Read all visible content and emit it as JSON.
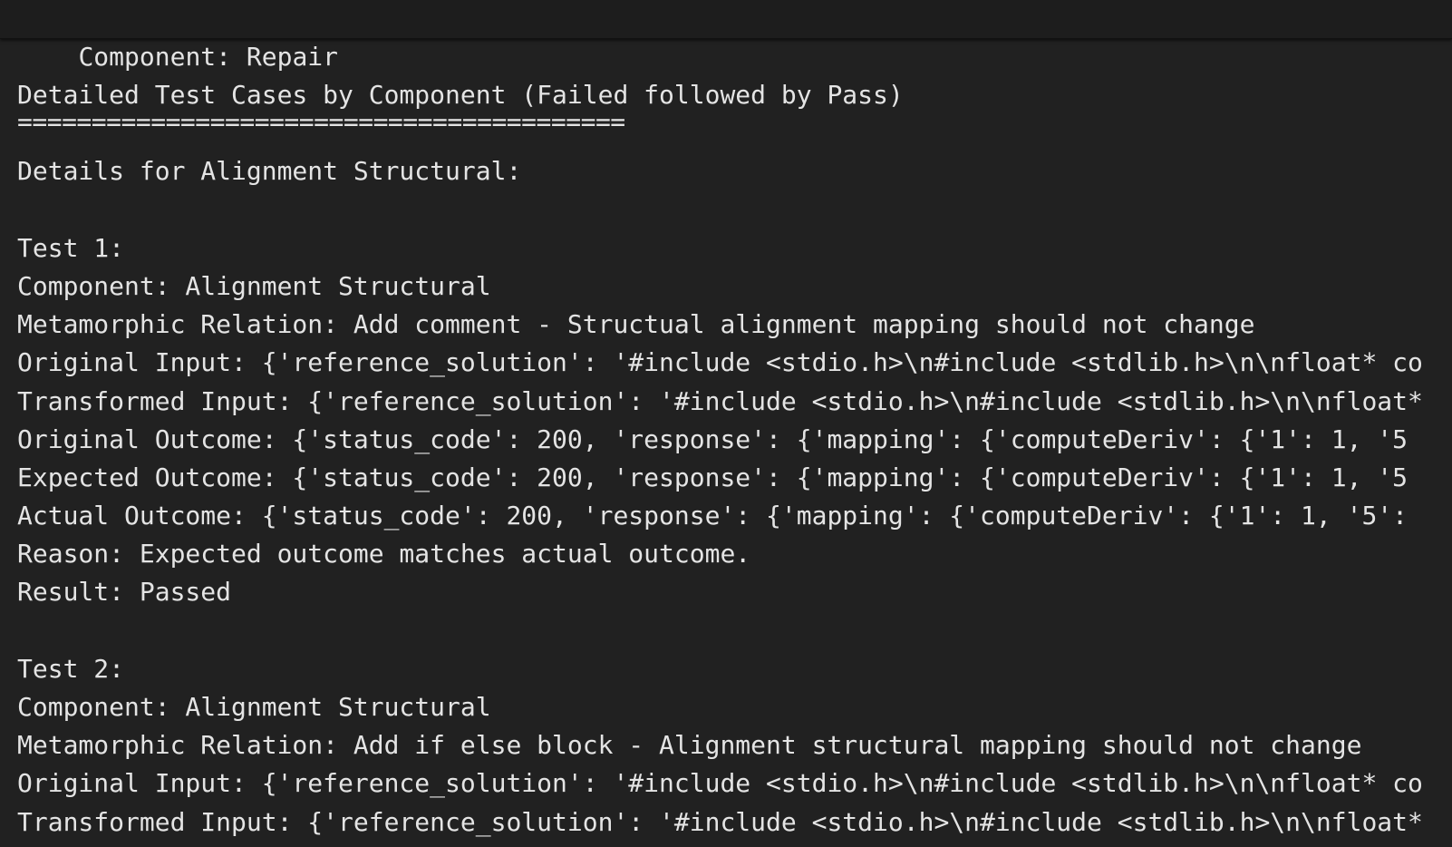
{
  "header": {
    "text": "Component: Repair"
  },
  "output": {
    "title": "Detailed Test Cases by Component (Failed followed by Pass)",
    "separator": "=========================================",
    "section_heading": "Details for Alignment Structural:",
    "tests": [
      {
        "label": "Test 1:",
        "component": "Component: Alignment Structural",
        "relation": "Metamorphic Relation: Add comment - Structual alignment mapping should not change",
        "original_input": "Original Input: {'reference_solution': '#include <stdio.h>\\n#include <stdlib.h>\\n\\nfloat* co",
        "transformed_input": "Transformed Input: {'reference_solution': '#include <stdio.h>\\n#include <stdlib.h>\\n\\nfloat*",
        "original_outcome": "Original Outcome: {'status_code': 200, 'response': {'mapping': {'computeDeriv': {'1': 1, '5",
        "expected_outcome": "Expected Outcome: {'status_code': 200, 'response': {'mapping': {'computeDeriv': {'1': 1, '5",
        "actual_outcome": "Actual Outcome: {'status_code': 200, 'response': {'mapping': {'computeDeriv': {'1': 1, '5':",
        "reason": "Reason: Expected outcome matches actual outcome.",
        "result": "Result: Passed"
      },
      {
        "label": "Test 2:",
        "component": "Component: Alignment Structural",
        "relation": "Metamorphic Relation: Add if else block - Alignment structural mapping should not change",
        "original_input": "Original Input: {'reference_solution': '#include <stdio.h>\\n#include <stdlib.h>\\n\\nfloat* co",
        "transformed_input": "Transformed Input: {'reference_solution': '#include <stdio.h>\\n#include <stdlib.h>\\n\\nfloat*"
      }
    ]
  }
}
